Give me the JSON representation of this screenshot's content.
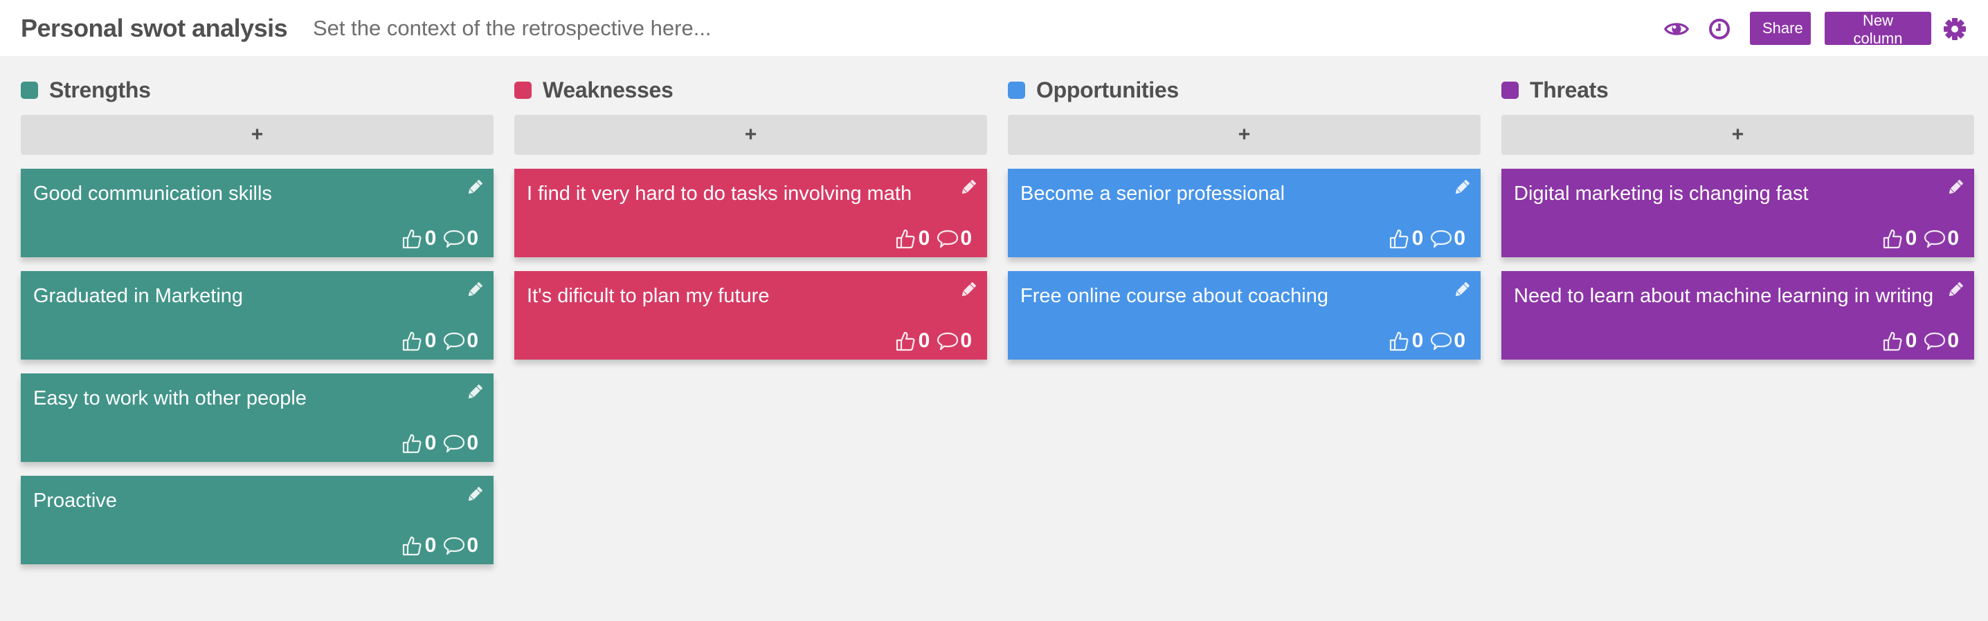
{
  "header": {
    "title": "Personal swot analysis",
    "context_placeholder": "Set the context of the retrospective here...",
    "share_label": "Share",
    "new_column_label": "New column",
    "icons": [
      "eye-icon",
      "clock-icon",
      "gear-icon"
    ],
    "accent_color": "#8c35a6"
  },
  "add_label": "+",
  "columns": [
    {
      "title": "Strengths",
      "color": "#429488",
      "cards": [
        {
          "text": "Good communication skills",
          "likes": "0",
          "comments": "0"
        },
        {
          "text": "Graduated in Marketing",
          "likes": "0",
          "comments": "0"
        },
        {
          "text": "Easy to work with other people",
          "likes": "0",
          "comments": "0"
        },
        {
          "text": "Proactive",
          "likes": "0",
          "comments": "0"
        }
      ]
    },
    {
      "title": "Weaknesses",
      "color": "#d63a63",
      "cards": [
        {
          "text": "I find it very hard to do tasks involving math",
          "likes": "0",
          "comments": "0"
        },
        {
          "text": "It's dificult to plan my future",
          "likes": "0",
          "comments": "0"
        }
      ]
    },
    {
      "title": "Opportunities",
      "color": "#4894e8",
      "cards": [
        {
          "text": "Become a senior professional",
          "likes": "0",
          "comments": "0"
        },
        {
          "text": "Free online course about coaching",
          "likes": "0",
          "comments": "0"
        }
      ]
    },
    {
      "title": "Threats",
      "color": "#8c35a6",
      "cards": [
        {
          "text": "Digital marketing is changing fast",
          "likes": "0",
          "comments": "0"
        },
        {
          "text": "Need to learn about machine learning in writing",
          "likes": "0",
          "comments": "0"
        }
      ]
    }
  ]
}
